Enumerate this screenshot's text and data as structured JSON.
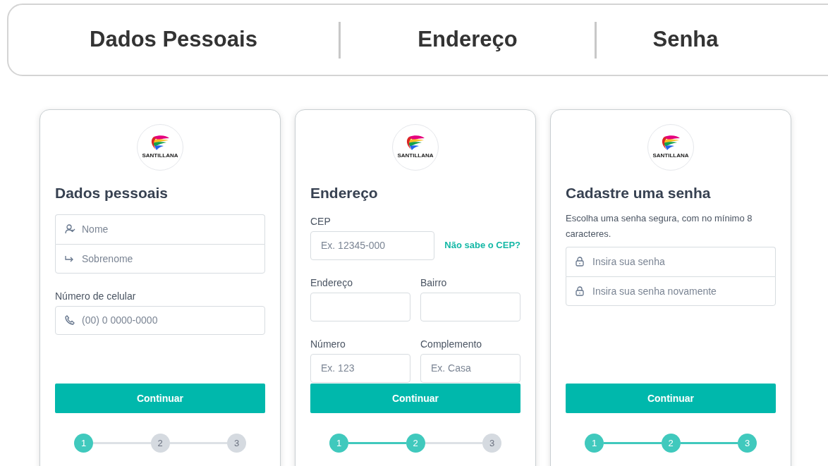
{
  "header_tabs": [
    {
      "label": "Dados Pessoais"
    },
    {
      "label": "Endereço"
    },
    {
      "label": "Senha"
    }
  ],
  "cards": [
    {
      "logo_text": "SANTILLANA",
      "title": "Dados pessoais",
      "sections": [
        {
          "kind": "group",
          "inputs": [
            {
              "kind": "person",
              "placeholder": "Nome"
            },
            {
              "kind": "arrow",
              "placeholder": "Sobrenome"
            }
          ]
        },
        {
          "kind": "field",
          "label": "Número de celular",
          "input": {
            "kind": "phone",
            "placeholder": "(00) 0 0000-0000"
          }
        }
      ],
      "button": "Continuar",
      "steps": [
        {
          "label": "1",
          "done": true
        },
        {
          "label": "2",
          "done": false
        },
        {
          "label": "3",
          "done": false
        }
      ]
    },
    {
      "logo_text": "SANTILLANA",
      "title": "Endereço",
      "sections": [
        {
          "kind": "field",
          "label": "CEP",
          "input": {
            "placeholder": "Ex. 12345-000"
          },
          "link": "Não sabe o CEP?"
        },
        {
          "kind": "row",
          "fields": [
            {
              "label": "Endereço"
            },
            {
              "label": "Bairro"
            }
          ]
        },
        {
          "kind": "row",
          "fields": [
            {
              "label": "Número",
              "input": {
                "placeholder": "Ex. 123"
              }
            },
            {
              "label": "Complemento",
              "input": {
                "placeholder": "Ex. Casa"
              }
            }
          ]
        }
      ],
      "button": "Continuar",
      "steps": [
        {
          "label": "1",
          "done": true
        },
        {
          "label": "2",
          "done": true
        },
        {
          "label": "3",
          "done": false
        }
      ]
    },
    {
      "logo_text": "SANTILLANA",
      "title": "Cadastre uma senha",
      "description": "Escolha uma senha segura, com no mínimo 8 caracteres.",
      "sections": [
        {
          "kind": "group",
          "inputs": [
            {
              "kind": "lock",
              "placeholder": "Insira sua senha"
            },
            {
              "kind": "lock",
              "placeholder": "Insira sua senha novamente"
            }
          ]
        }
      ],
      "button": "Continuar",
      "steps": [
        {
          "label": "1",
          "done": true
        },
        {
          "label": "2",
          "done": true
        },
        {
          "label": "3",
          "done": true
        }
      ]
    }
  ]
}
